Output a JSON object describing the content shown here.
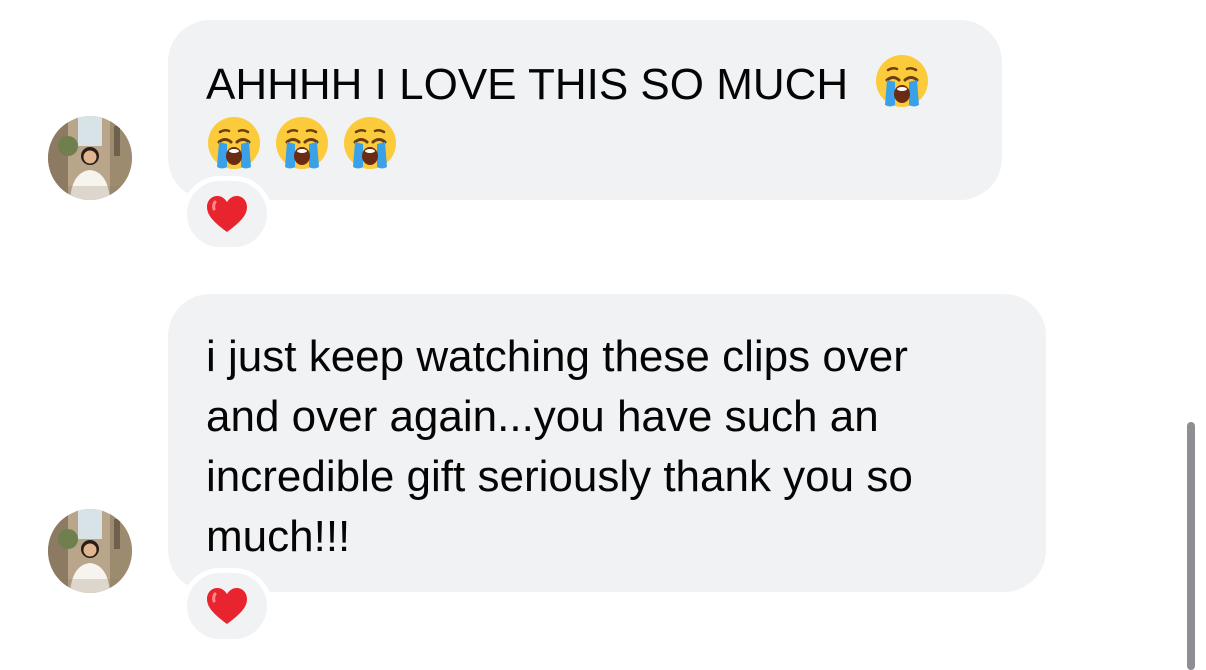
{
  "messages": [
    {
      "text": "AHHHH I LOVE THIS SO MUCH",
      "emojis": [
        "loudly-crying-face",
        "loudly-crying-face",
        "loudly-crying-face",
        "loudly-crying-face"
      ],
      "reaction": "red-heart"
    },
    {
      "text": "i just keep watching these clips over\nand over again...you have such an\nincredible gift seriously thank you so\nmuch!!!",
      "reaction": "red-heart"
    }
  ],
  "colors": {
    "bubble_bg": "#f1f2f4",
    "text": "#050505",
    "heart": "#e8242e",
    "scrollbar": "#8e8e93"
  }
}
